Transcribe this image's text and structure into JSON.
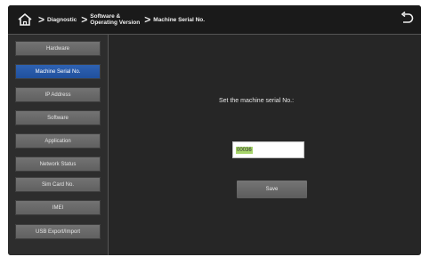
{
  "breadcrumb": {
    "items": [
      "Diagnostic",
      "Software &",
      "Operating Version",
      "Machine Serial No."
    ]
  },
  "sidebar": {
    "active_index": 1,
    "items": [
      {
        "label": "Hardware"
      },
      {
        "label": "Machine Serial No."
      },
      {
        "label": "IP Address"
      },
      {
        "label": "Software"
      },
      {
        "label": "Application"
      },
      {
        "label": "Network Status"
      },
      {
        "label": "Sim Card No."
      },
      {
        "label": "IMEI"
      },
      {
        "label": "USB Export/Import"
      }
    ]
  },
  "main": {
    "prompt": "Set the machine serial No.:",
    "serial_value": "00036",
    "save_label": "Save"
  },
  "icons": {
    "home": "home-icon",
    "back": "back-arrow-icon"
  },
  "colors": {
    "active_item": "#2f63b4",
    "selection_highlight": "#a6d46a"
  }
}
